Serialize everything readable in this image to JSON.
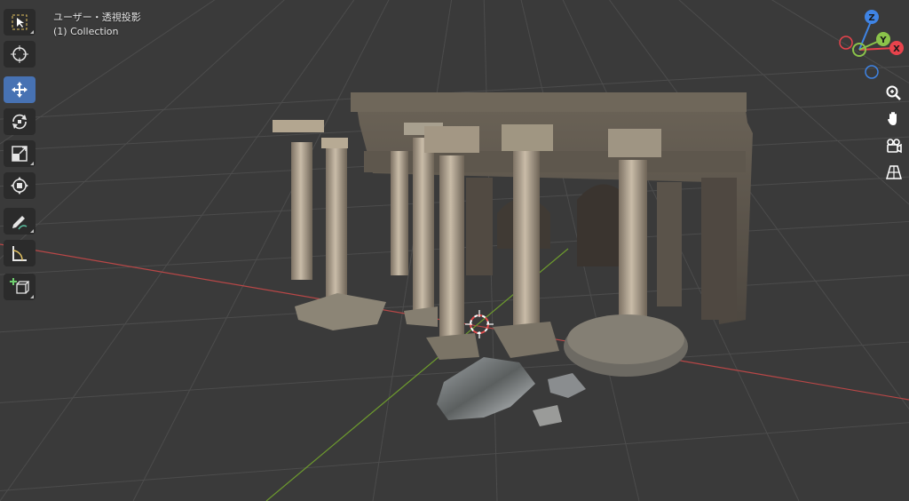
{
  "viewport": {
    "header_title": "ユーザー・透視投影",
    "collection_label": "(1) Collection"
  },
  "toolbar": {
    "tools": [
      {
        "name": "select-box-tool",
        "icon": "select-box-icon",
        "active": false
      },
      {
        "name": "cursor-tool",
        "icon": "cursor-crosshair-icon",
        "active": false
      },
      {
        "name": "move-tool",
        "icon": "move-arrows-icon",
        "active": true
      },
      {
        "name": "rotate-tool",
        "icon": "rotate-icon",
        "active": false
      },
      {
        "name": "scale-tool",
        "icon": "scale-icon",
        "active": false
      },
      {
        "name": "transform-tool",
        "icon": "transform-icon",
        "active": false
      },
      {
        "name": "annotate-tool",
        "icon": "pencil-icon",
        "active": false
      },
      {
        "name": "measure-tool",
        "icon": "ruler-icon",
        "active": false
      },
      {
        "name": "add-cube-tool",
        "icon": "add-cube-icon",
        "active": false
      }
    ]
  },
  "gizmo": {
    "axis_z": "Z",
    "axis_y": "Y",
    "axis_x": "X",
    "colors": {
      "x": "#e8434c",
      "y": "#8bc34a",
      "z": "#3f84e5"
    }
  },
  "nav_buttons": [
    "zoom-icon",
    "hand-pan-icon",
    "camera-icon",
    "grid-perspective-icon"
  ],
  "colors": {
    "background": "#3a3a3a",
    "grid_line": "#4a4a4a",
    "x_axis_line": "#b84747",
    "y_axis_line": "#6d9a2e",
    "active_tool": "#4772b3"
  }
}
